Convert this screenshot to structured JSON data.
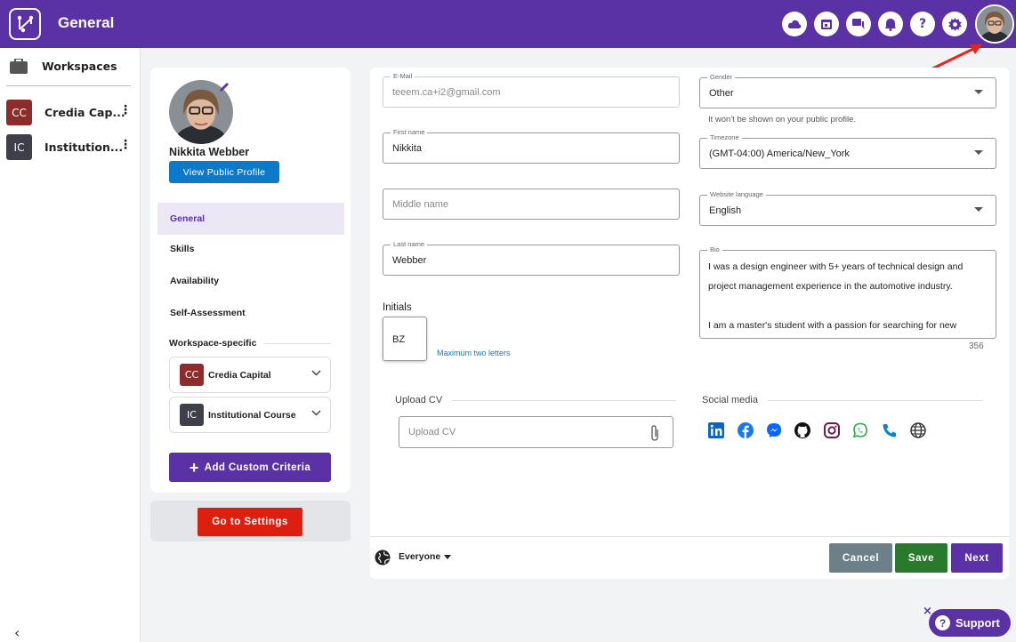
{
  "header": {
    "title": "General",
    "icons": [
      "cloud-icon",
      "calendar-icon",
      "chat-icon",
      "bell-icon",
      "help-icon",
      "gear-icon"
    ]
  },
  "sidebar": {
    "title": "Workspaces",
    "items": [
      {
        "badge": "CC",
        "label": "Credia Cap...",
        "color": "#8e2c2c"
      },
      {
        "badge": "IC",
        "label": "Institution...",
        "color": "#3f3f4a"
      }
    ]
  },
  "profile": {
    "name": "Nikkita Webber",
    "view_public_profile": "View Public Profile",
    "menu": [
      {
        "label": "General",
        "active": true
      },
      {
        "label": "Skills",
        "active": false
      },
      {
        "label": "Availability",
        "active": false
      },
      {
        "label": "Self-Assessment",
        "active": false
      }
    ],
    "workspace_specific": "Workspace-specific",
    "workspaces": [
      {
        "badge": "CC",
        "label": "Credia Capital",
        "color": "#8e2c2c"
      },
      {
        "badge": "IC",
        "label": "Institutional Course",
        "color": "#3f3f4a"
      }
    ],
    "add_custom_criteria": "Add Custom Criteria",
    "go_to_settings": "Go to Settings"
  },
  "form": {
    "email": {
      "legend": "E-Mail",
      "value": "teeem.ca+i2@gmail.com"
    },
    "first_name": {
      "legend": "First name",
      "value": "Nikkita"
    },
    "middle_name": {
      "placeholder": "Middle name"
    },
    "last_name": {
      "legend": "Last name",
      "value": "Webber"
    },
    "initials": {
      "label": "Initials",
      "value": "BZ",
      "hint": "Maximum two letters"
    },
    "gender": {
      "legend": "Gender",
      "value": "Other",
      "hint": "It won't be shown on your public profile."
    },
    "timezone": {
      "legend": "Timezone",
      "value": "(GMT-04:00) America/New_York"
    },
    "language": {
      "legend": "Website language",
      "value": "English"
    },
    "bio": {
      "legend": "Bio",
      "line1": "I was a design engineer with 5+ years of technical design and",
      "line2": "project management experience in the automotive industry.",
      "line3": "",
      "line4": "I am a master's student with a passion for searching for new",
      "count": "356"
    },
    "upload_cv": {
      "title": "Upload CV",
      "placeholder": "Upload CV"
    },
    "social": {
      "title": "Social media",
      "icons": [
        "linkedin-icon",
        "facebook-icon",
        "messenger-icon",
        "github-icon",
        "instagram-icon",
        "whatsapp-icon",
        "phone-icon",
        "globe-icon"
      ]
    }
  },
  "footer": {
    "visibility": "Everyone",
    "cancel": "Cancel",
    "save": "Save",
    "next": "Next"
  },
  "support": {
    "label": "Support",
    "close": "×"
  },
  "colors": {
    "brand": "#5b31a6",
    "link": "#0c79c9",
    "danger": "#dd1f10",
    "cancel": "#6c8089",
    "save": "#2a7a2e"
  }
}
